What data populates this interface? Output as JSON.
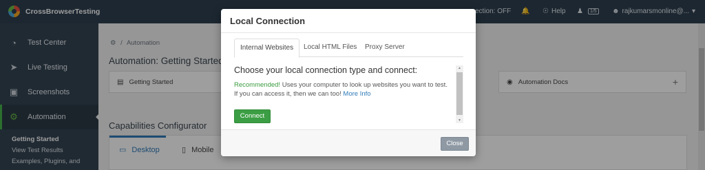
{
  "app": {
    "name": "CrossBrowserTesting"
  },
  "topbar": {
    "connection_label": "ection: OFF",
    "help_label": "Help",
    "parallel_badge": "1/5",
    "user_label": "rajkumarsmonline@..."
  },
  "sidebar": {
    "items": [
      {
        "label": "Test Center",
        "icon": "gauge-icon"
      },
      {
        "label": "Live Testing",
        "icon": "cursor-icon"
      },
      {
        "label": "Screenshots",
        "icon": "camera-icon"
      },
      {
        "label": "Automation",
        "icon": "gears-icon"
      }
    ],
    "sub_items": [
      "Getting Started",
      "View Test Results",
      "Examples, Plugins, and"
    ]
  },
  "main": {
    "breadcrumb": "Automation",
    "title": "Automation: Getting Started",
    "cards": [
      {
        "label": "Getting Started"
      },
      {
        "label": "Automation Docs"
      }
    ],
    "section_title": "Capabilities Configurator",
    "platform_tabs": [
      "Desktop",
      "Mobile"
    ]
  },
  "modal": {
    "title": "Local Connection",
    "tabs": [
      "Internal Websites",
      "Local HTML Files",
      "Proxy Server"
    ],
    "pane_title": "Choose your local connection type and connect:",
    "recommended": "Recommended!",
    "description": " Uses your computer to look up websites you want to test. If you can access it, then we can too! ",
    "more_info": "More Info",
    "connect_label": "Connect",
    "close_label": "Close"
  },
  "colors": {
    "topbar": "#2e3f4f",
    "sidebar": "#354553",
    "active_accent": "#48b34d",
    "connect_button": "#3c9e44",
    "link": "#2f7ab8"
  }
}
